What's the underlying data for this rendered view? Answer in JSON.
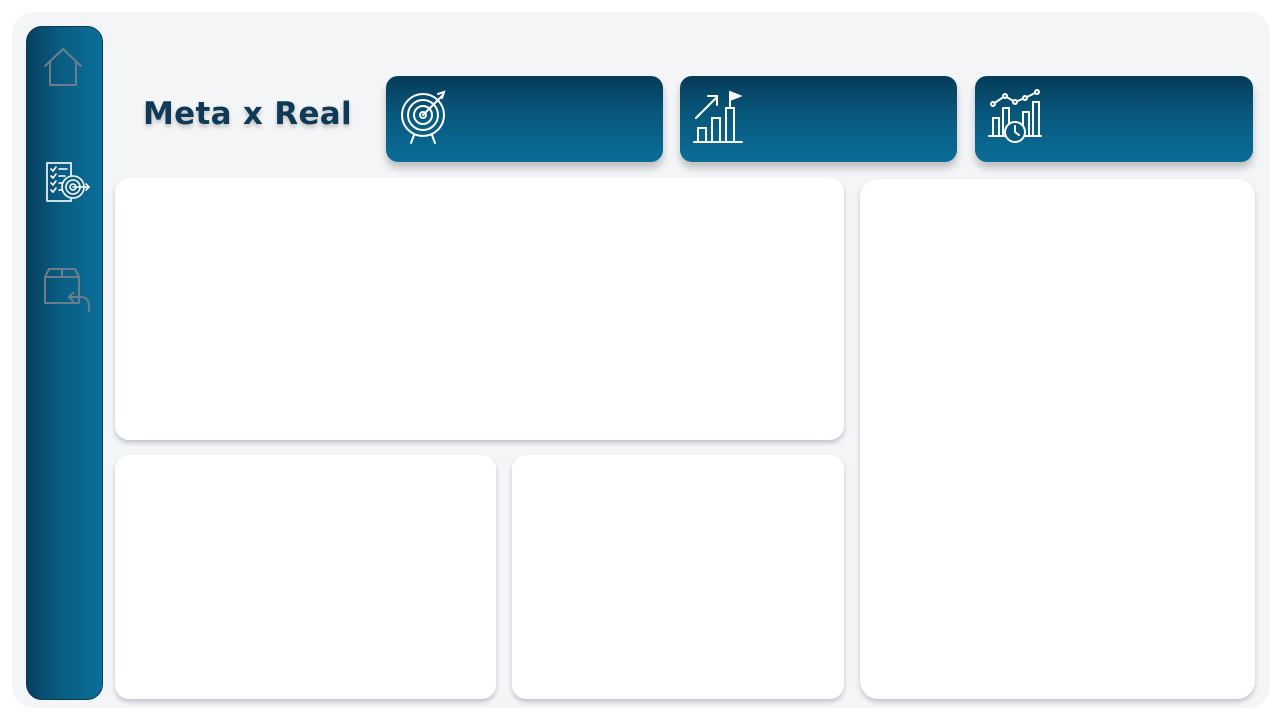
{
  "page": {
    "title": "Meta x Real"
  },
  "sidebar": {
    "items": [
      {
        "icon": "home-icon",
        "state": "inactive"
      },
      {
        "icon": "goal-report-icon",
        "state": "active"
      },
      {
        "icon": "box-return-icon",
        "state": "inactive"
      }
    ]
  },
  "kpis": [
    {
      "icon": "target-icon"
    },
    {
      "icon": "growth-chart-flag-icon"
    },
    {
      "icon": "chart-clock-icon"
    }
  ],
  "colors": {
    "primary": "#0a6e98",
    "primary_dark": "#063b58",
    "title": "#0f3a57",
    "background": "#f4f5f7",
    "icon_inactive": "#6a7e8c"
  }
}
